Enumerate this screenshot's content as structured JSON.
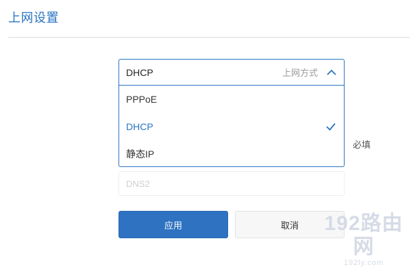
{
  "page": {
    "title": "上网设置"
  },
  "connection_type": {
    "value": "DHCP",
    "label": "上网方式",
    "options": [
      {
        "label": "PPPoE",
        "selected": false
      },
      {
        "label": "DHCP",
        "selected": true
      },
      {
        "label": "静态IP",
        "selected": false
      }
    ]
  },
  "required_text": "必填",
  "dns2": {
    "placeholder": "DNS2"
  },
  "buttons": {
    "apply": "应用",
    "cancel": "取消"
  },
  "watermark": {
    "main": "192路由网",
    "sub": "192ly.com"
  },
  "colors": {
    "accent": "#2a74c2",
    "button_primary": "#2e72c1"
  },
  "icons": {
    "dropdown": "chevron-up-icon",
    "selected": "check-icon"
  }
}
